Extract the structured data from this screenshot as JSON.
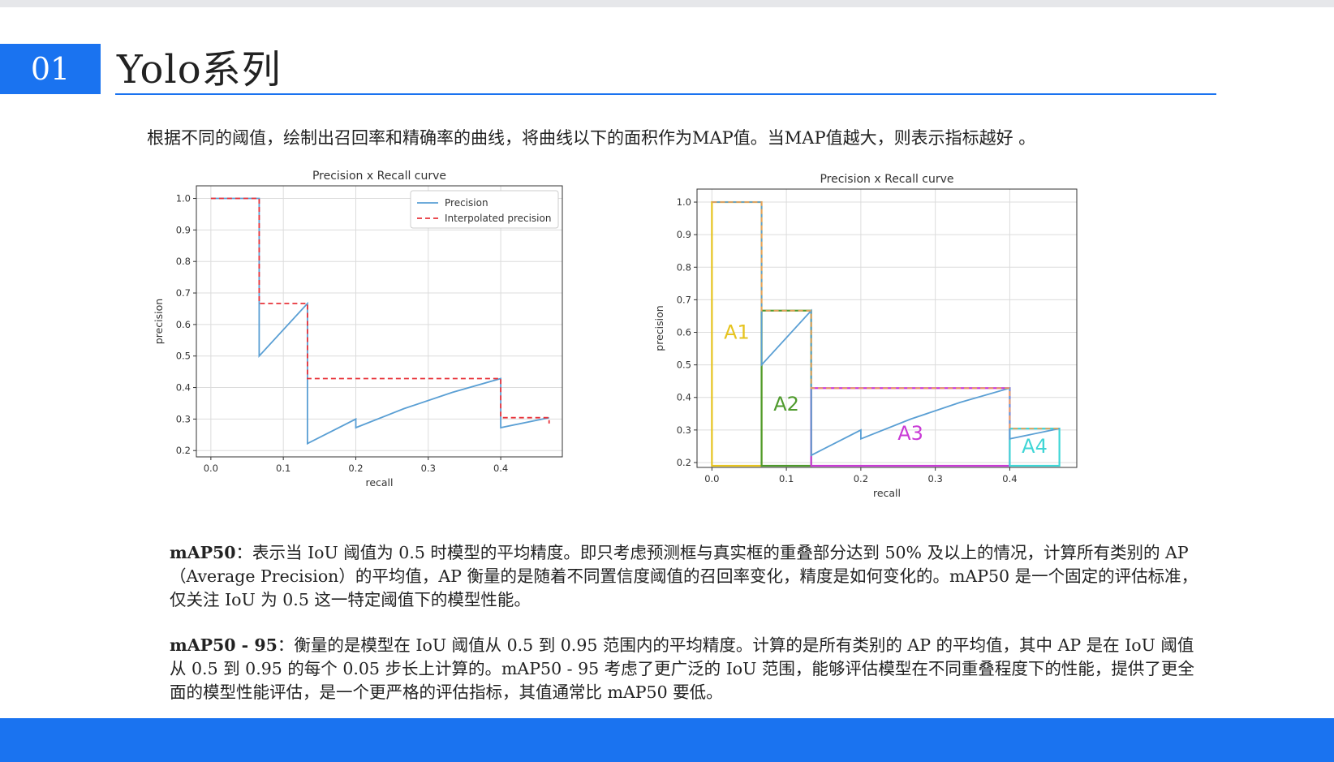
{
  "slide": {
    "number": "01",
    "title": "Yolo系列",
    "intro": "根据不同的阈值，绘制出召回率和精确率的曲线，将曲线以下的面积作为MAP值。当MAP值越大，则表示指标越好  。"
  },
  "paragraphs": [
    {
      "term": "mAP50",
      "text": "：表示当 IoU 阈值为 0.5 时模型的平均精度。即只考虑预测框与真实框的重叠部分达到 50% 及以上的情况，计算所有类别的 AP（Average Precision）的平均值，AP 衡量的是随着不同置信度阈值的召回率变化，精度是如何变化的。mAP50 是一个固定的评估标准，仅关注 IoU 为 0.5 这一特定阈值下的模型性能。"
    },
    {
      "term": "mAP50 - 95",
      "text": "：衡量的是模型在 IoU 阈值从 0.5 到 0.95 范围内的平均精度。计算的是所有类别的 AP 的平均值，其中 AP 是在 IoU 阈值从 0.5 到 0.95 的每个 0.05 步长上计算的。mAP50 - 95 考虑了更广泛的 IoU 范围，能够评估模型在不同重叠程度下的性能，提供了更全面的模型性能评估，是一个更严格的评估指标，其值通常比 mAP50 要低。"
    }
  ],
  "chart_data": [
    {
      "type": "line",
      "title": "Precision x Recall curve",
      "xlabel": "recall",
      "ylabel": "precision",
      "xlim": [
        -0.02,
        0.485
      ],
      "ylim": [
        0.18,
        1.04
      ],
      "xticks": [
        0.0,
        0.1,
        0.2,
        0.3,
        0.4
      ],
      "xtick_labels": [
        "0.0",
        "0.1",
        "0.2",
        "0.3",
        "0.4"
      ],
      "yticks": [
        0.2,
        0.3,
        0.4,
        0.5,
        0.6,
        0.7,
        0.8,
        0.9,
        1.0
      ],
      "ytick_labels": [
        "0.2",
        "0.3",
        "0.4",
        "0.5",
        "0.6",
        "0.7",
        "0.8",
        "0.9",
        "1.0"
      ],
      "grid": true,
      "legend": "top-right",
      "series": [
        {
          "name": "Precision",
          "color": "#5a9fd4",
          "style": "solid",
          "x": [
            0.0,
            0.0667,
            0.0667,
            0.1333,
            0.1333,
            0.2,
            0.2,
            0.2667,
            0.3333,
            0.4,
            0.4,
            0.4667
          ],
          "y": [
            1.0,
            1.0,
            0.5,
            0.6667,
            0.2222,
            0.3,
            0.2727,
            0.3333,
            0.3846,
            0.4286,
            0.2727,
            0.3043
          ]
        },
        {
          "name": "Interpolated precision",
          "color": "#e8333a",
          "style": "dashed",
          "x": [
            0.0,
            0.0667,
            0.0667,
            0.1333,
            0.1333,
            0.4,
            0.4,
            0.4667,
            0.4667
          ],
          "y": [
            1.0,
            1.0,
            0.6667,
            0.6667,
            0.4286,
            0.4286,
            0.3043,
            0.3043,
            0.2857
          ]
        }
      ]
    },
    {
      "type": "line",
      "title": "Precision x Recall curve",
      "xlabel": "recall",
      "ylabel": "precision",
      "xlim": [
        -0.02,
        0.49
      ],
      "ylim": [
        0.185,
        1.04
      ],
      "xticks": [
        0.0,
        0.1,
        0.2,
        0.3,
        0.4
      ],
      "xtick_labels": [
        "0.0",
        "0.1",
        "0.2",
        "0.3",
        "0.4"
      ],
      "yticks": [
        0.2,
        0.3,
        0.4,
        0.5,
        0.6,
        0.7,
        0.8,
        0.9,
        1.0
      ],
      "ytick_labels": [
        "0.2",
        "0.3",
        "0.4",
        "0.5",
        "0.6",
        "0.7",
        "0.8",
        "0.9",
        "1.0"
      ],
      "grid": true,
      "series": [
        {
          "color": "#5a9fd4",
          "style": "solid",
          "x": [
            0.0,
            0.0667,
            0.0667,
            0.1333,
            0.1333,
            0.2,
            0.2,
            0.2667,
            0.3333,
            0.4,
            0.4,
            0.4667
          ],
          "y": [
            1.0,
            1.0,
            0.5,
            0.6667,
            0.2222,
            0.3,
            0.2727,
            0.3333,
            0.3846,
            0.4286,
            0.2727,
            0.3043
          ]
        },
        {
          "color": "#e8a05a",
          "style": "dashed",
          "x": [
            0.0,
            0.0667,
            0.0667,
            0.1333,
            0.1333,
            0.4,
            0.4,
            0.4667
          ],
          "y": [
            1.0,
            1.0,
            0.6667,
            0.6667,
            0.4286,
            0.4286,
            0.3043,
            0.3043
          ]
        }
      ],
      "areas": [
        {
          "label": "A1",
          "color": "#e6c420",
          "x0": 0.0,
          "x1": 0.0667,
          "y0": 0.19,
          "y1": 1.0
        },
        {
          "label": "A2",
          "color": "#4e9a2c",
          "x0": 0.0667,
          "x1": 0.1333,
          "y0": 0.19,
          "y1": 0.6667
        },
        {
          "label": "A3",
          "color": "#c93ad6",
          "x0": 0.1333,
          "x1": 0.4,
          "y0": 0.19,
          "y1": 0.4286
        },
        {
          "label": "A4",
          "color": "#3fd6d6",
          "x0": 0.4,
          "x1": 0.4667,
          "y0": 0.19,
          "y1": 0.3043
        }
      ]
    }
  ]
}
